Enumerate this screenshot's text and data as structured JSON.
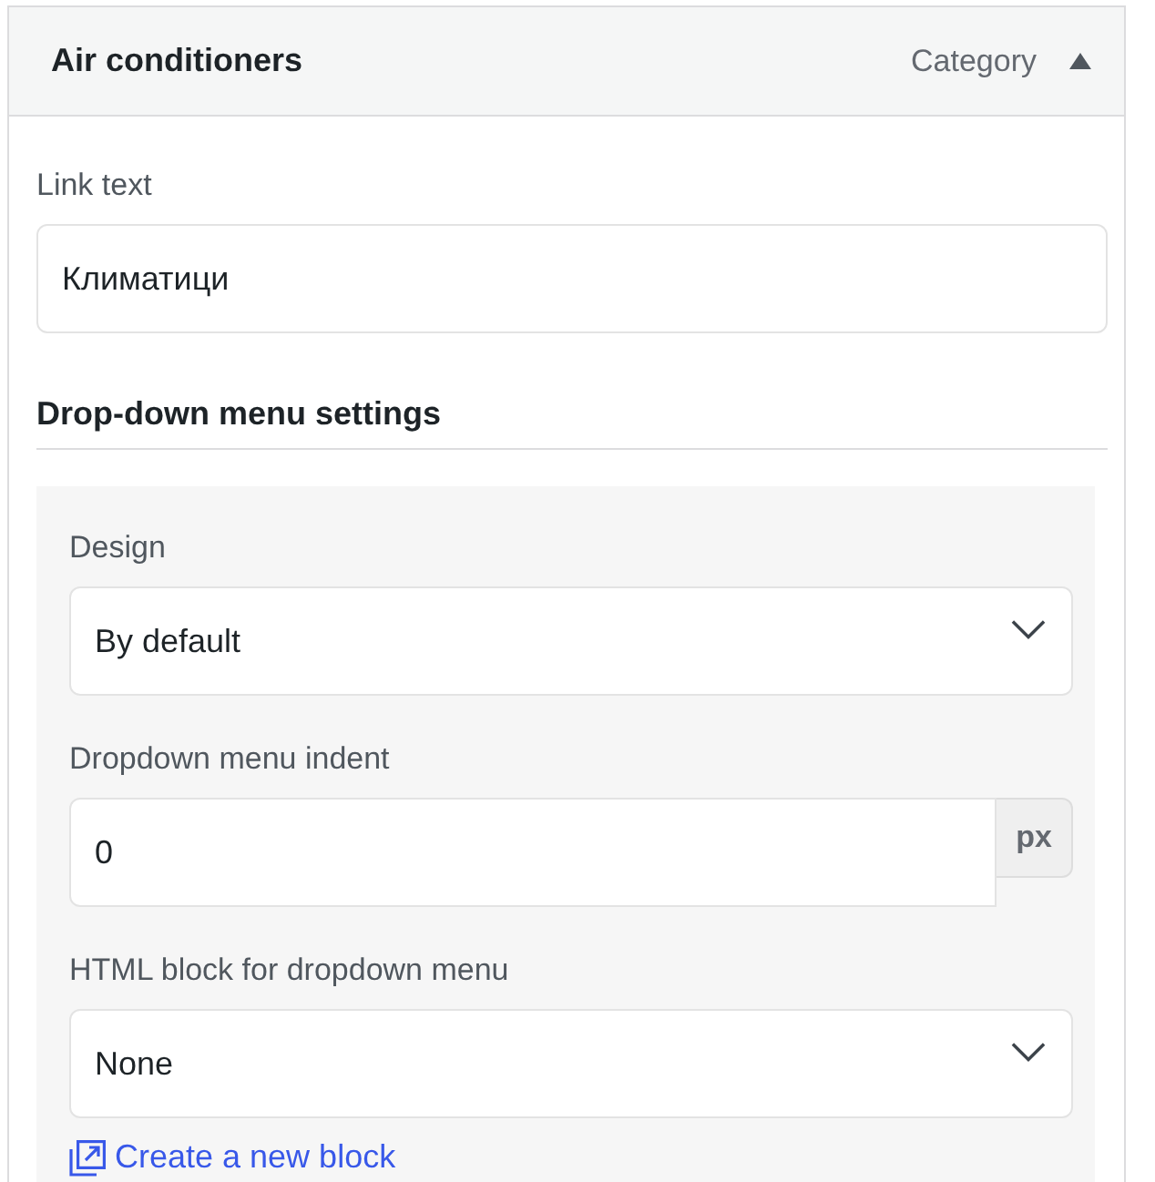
{
  "panel": {
    "title": "Air conditioners",
    "type_label": "Category",
    "expanded": true
  },
  "link_text": {
    "label": "Link text",
    "value": "Климатици"
  },
  "section": {
    "title": "Drop-down menu settings"
  },
  "fields": [
    {
      "kind": "select",
      "label": "Design",
      "value": "By default"
    },
    {
      "kind": "number",
      "label": "Dropdown menu indent",
      "value": "0",
      "unit": "px"
    },
    {
      "kind": "select",
      "label": "HTML block for dropdown menu",
      "value": "None"
    }
  ],
  "create_link": {
    "label": "Create a new block"
  }
}
